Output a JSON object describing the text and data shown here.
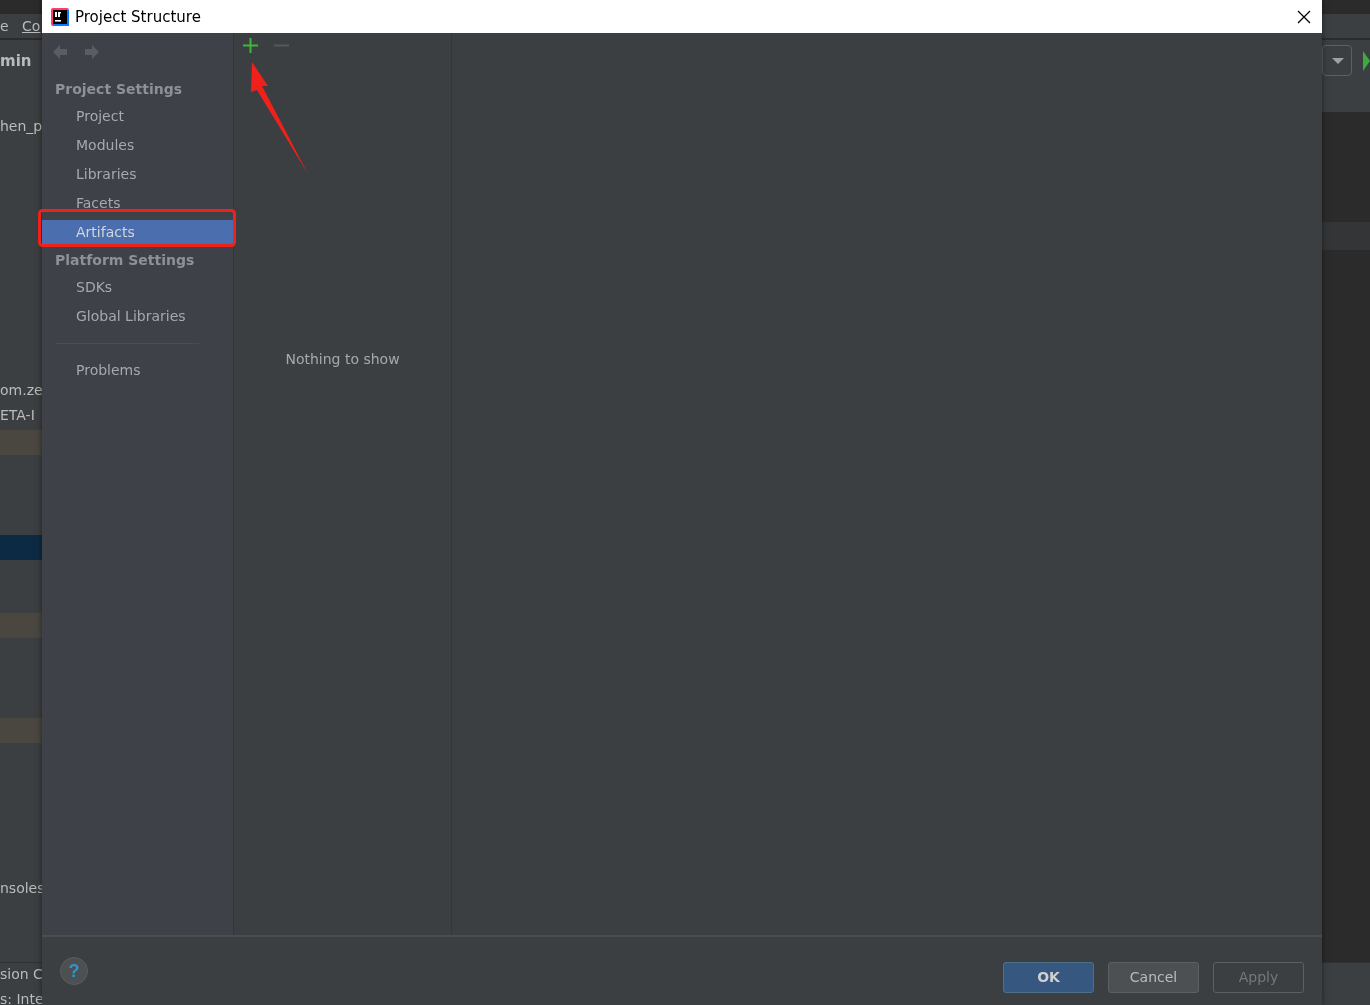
{
  "ide_background": {
    "fragments": [
      {
        "text": "e"
      },
      {
        "text": "Co"
      },
      {
        "text": "min"
      },
      {
        "text": "hen_p"
      },
      {
        "text": "om.ze"
      },
      {
        "text": "ETA-I"
      },
      {
        "text": "nsoles"
      },
      {
        "text": "sion C"
      },
      {
        "text": "s: Inte"
      }
    ]
  },
  "dialog": {
    "title": "Project Structure",
    "nav": [
      {
        "kind": "back",
        "disabled": true
      },
      {
        "kind": "forward",
        "disabled": true
      }
    ],
    "sidebar": [
      {
        "heading": "Project Settings",
        "items": [
          {
            "label": "Project",
            "selected": false
          },
          {
            "label": "Modules",
            "selected": false
          },
          {
            "label": "Libraries",
            "selected": false
          },
          {
            "label": "Facets",
            "selected": false
          },
          {
            "label": "Artifacts",
            "selected": true
          }
        ]
      },
      {
        "heading": "Platform Settings",
        "items": [
          {
            "label": "SDKs",
            "selected": false
          },
          {
            "label": "Global Libraries",
            "selected": false
          }
        ]
      },
      {
        "items": [
          {
            "label": "Problems",
            "selected": false
          }
        ]
      }
    ],
    "toolbar": [
      {
        "kind": "add",
        "disabled": false
      },
      {
        "kind": "remove",
        "disabled": true
      }
    ],
    "empty_text": "Nothing to show",
    "help": "?",
    "buttons": [
      {
        "label": "OK",
        "kind": "primary",
        "disabled": false
      },
      {
        "label": "Cancel",
        "kind": "normal",
        "disabled": false
      },
      {
        "label": "Apply",
        "kind": "normal",
        "disabled": true
      }
    ]
  }
}
